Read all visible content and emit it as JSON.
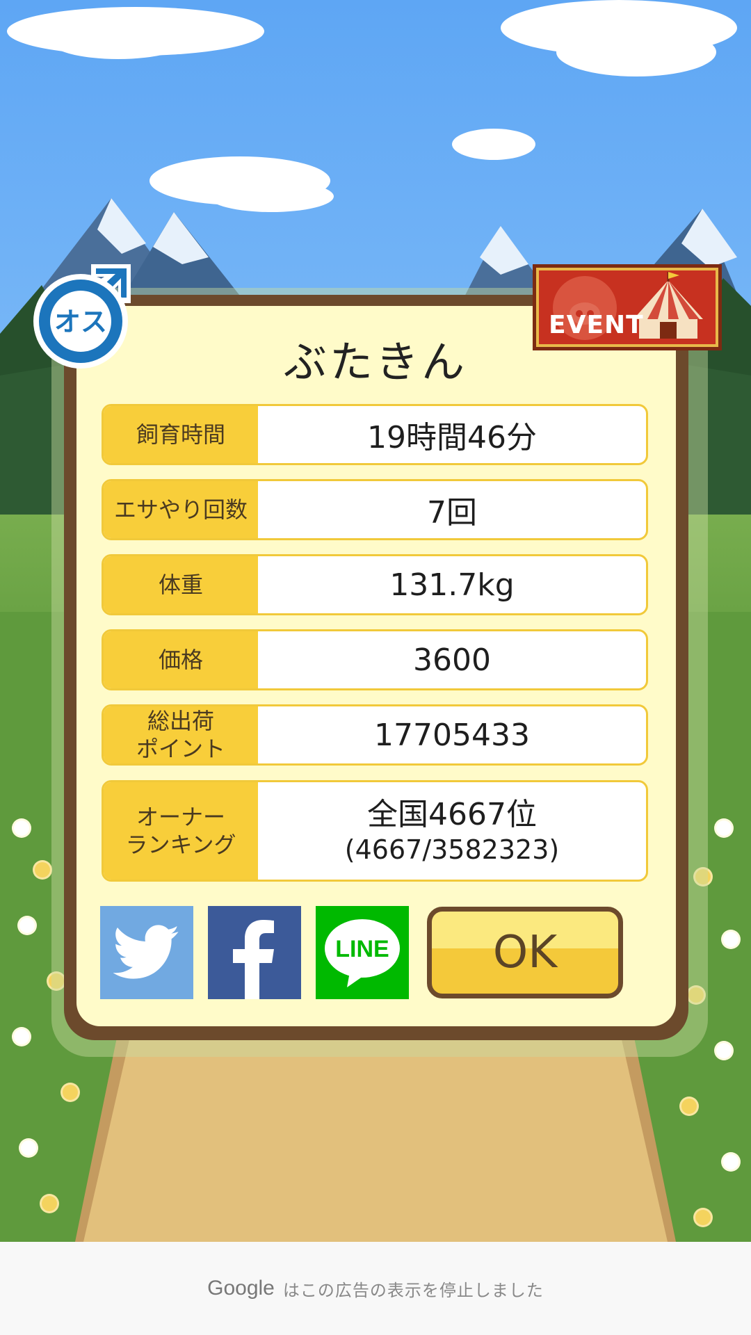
{
  "pet": {
    "name": "ぶたきん"
  },
  "gender_badge": {
    "text": "オス"
  },
  "event_badge": {
    "label": "EVENT"
  },
  "stats": [
    {
      "label": "飼育時間",
      "value": "19時間46分"
    },
    {
      "label": "エサやり回数",
      "value": "7回"
    },
    {
      "label": "体重",
      "value": "131.7kg"
    },
    {
      "label": "価格",
      "value": "3600"
    },
    {
      "label": "総出荷\nポイント",
      "value": "17705433"
    },
    {
      "label": "オーナー\nランキング",
      "value": "全国4667位",
      "sub_value": "(4667/3582323)"
    }
  ],
  "share": {
    "twitter": "twitter",
    "facebook": "f",
    "line": "LINE"
  },
  "ok_button": {
    "label": "OK"
  },
  "ad_notice": {
    "brand": "Google",
    "text": "はこの広告の表示を停止しました"
  },
  "colors": {
    "label_bg": "#f8ce3a",
    "panel_border": "#6c4a2c",
    "panel_bg": "#fffbc9",
    "twitter": "#71a9e1",
    "facebook": "#3c5a99",
    "line": "#00b900"
  }
}
